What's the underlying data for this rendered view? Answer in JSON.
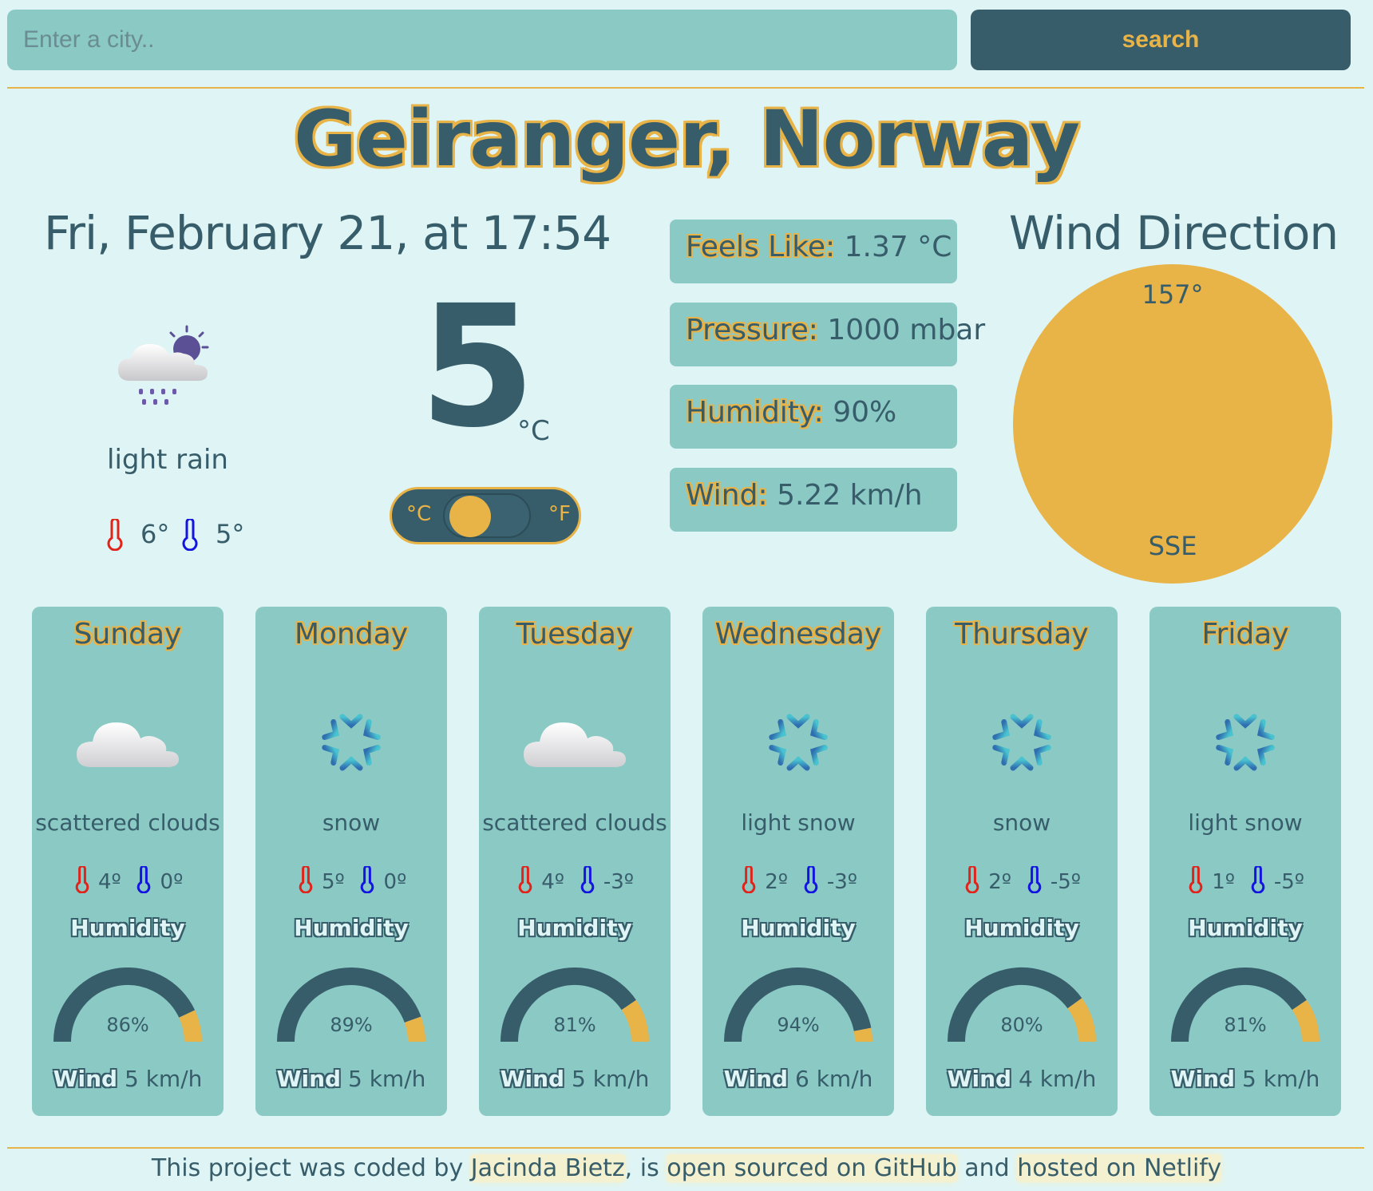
{
  "search": {
    "placeholder": "Enter a city..",
    "button_label": "search"
  },
  "location": {
    "title": "Geiranger, Norway"
  },
  "current": {
    "date_line": "Fri, February 21, at 17:54",
    "icon": "cloud-rain-sun-icon",
    "description": "light rain",
    "max": "6°",
    "min": "5°",
    "temperature": "5",
    "unit": "°C",
    "toggle": {
      "c_label": "°C",
      "f_label": "°F",
      "selected": "°C"
    }
  },
  "stats": [
    {
      "label": "Feels Like:",
      "value": "1.37 °C"
    },
    {
      "label": "Pressure:",
      "value": "1000 mbar"
    },
    {
      "label": "Humidity:",
      "value": "90%"
    },
    {
      "label": "Wind:",
      "value": "5.22 km/h"
    }
  ],
  "wind_direction": {
    "title": "Wind Direction",
    "degrees": "157°",
    "angle": 157,
    "cardinal": "SSE"
  },
  "forecast": [
    {
      "day": "Sunday",
      "icon": "cloud-icon",
      "desc": "scattered clouds",
      "max": "4º",
      "min": "0º",
      "humidity_label": "Humidity",
      "humidity": 86,
      "humidity_text": "86%",
      "wind_label": "Wind",
      "wind": "5 km/h"
    },
    {
      "day": "Monday",
      "icon": "snowflake-icon",
      "desc": "snow",
      "max": "5º",
      "min": "0º",
      "humidity_label": "Humidity",
      "humidity": 89,
      "humidity_text": "89%",
      "wind_label": "Wind",
      "wind": "5 km/h"
    },
    {
      "day": "Tuesday",
      "icon": "cloud-icon",
      "desc": "scattered clouds",
      "max": "4º",
      "min": "-3º",
      "humidity_label": "Humidity",
      "humidity": 81,
      "humidity_text": "81%",
      "wind_label": "Wind",
      "wind": "5 km/h"
    },
    {
      "day": "Wednesday",
      "icon": "snowflake-icon",
      "desc": "light snow",
      "max": "2º",
      "min": "-3º",
      "humidity_label": "Humidity",
      "humidity": 94,
      "humidity_text": "94%",
      "wind_label": "Wind",
      "wind": "6 km/h"
    },
    {
      "day": "Thursday",
      "icon": "snowflake-icon",
      "desc": "snow",
      "max": "2º",
      "min": "-5º",
      "humidity_label": "Humidity",
      "humidity": 80,
      "humidity_text": "80%",
      "wind_label": "Wind",
      "wind": "4 km/h"
    },
    {
      "day": "Friday",
      "icon": "snowflake-icon",
      "desc": "light snow",
      "max": "1º",
      "min": "-5º",
      "humidity_label": "Humidity",
      "humidity": 81,
      "humidity_text": "81%",
      "wind_label": "Wind",
      "wind": "5 km/h"
    }
  ],
  "footer": {
    "prefix": "This project was coded by ",
    "author": "Jacinda Bietz",
    "mid1": ", is ",
    "github": "open sourced on GitHub",
    "mid2": " and ",
    "netlify": "hosted on Netlify"
  },
  "colors": {
    "background": "#dff4f4",
    "card": "#8bc9c4",
    "dark": "#375d6b",
    "accent": "#e8b347",
    "hot": "#e0241b",
    "cold": "#1414e0"
  }
}
